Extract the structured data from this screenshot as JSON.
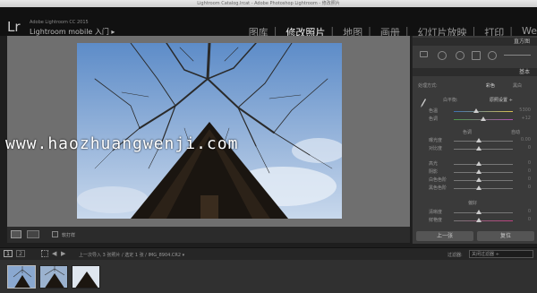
{
  "window": {
    "title": "Lightroom Catalog.lrcat - Adobe Photoshop Lightroom - 修改照片"
  },
  "identity": {
    "logo": "Lr",
    "product_line": "Adobe Lightroom CC 2015",
    "mobile_label": "Lightroom mobile 入门 ▸"
  },
  "modules": [
    {
      "label": "图库",
      "active": false
    },
    {
      "label": "修改照片",
      "active": true
    },
    {
      "label": "地图",
      "active": false
    },
    {
      "label": "画册",
      "active": false
    },
    {
      "label": "幻灯片放映",
      "active": false
    },
    {
      "label": "打印",
      "active": false
    },
    {
      "label": "We",
      "active": false
    }
  ],
  "watermark": "www.haozhuangwenji.com",
  "right_panel": {
    "histogram_label": "直方图",
    "basic_label": "基本",
    "treatment_label": "处理方式:",
    "color_option": "彩色",
    "bw_option": "黑白",
    "wb_label": "白平衡:",
    "wb_value": "原照设置 ÷",
    "temp_label": "色温",
    "temp_value": "5300",
    "tint_label": "色调",
    "tint_value": "+12",
    "tone_label": "色调",
    "auto_label": "自动",
    "exposure_label": "曝光度",
    "exposure_value": "0.00",
    "contrast_label": "对比度",
    "contrast_value": "0",
    "highlights_label": "高光",
    "highlights_value": "0",
    "shadows_label": "阴影",
    "shadows_value": "0",
    "whites_label": "白色色阶",
    "whites_value": "0",
    "blacks_label": "黑色色阶",
    "blacks_value": "0",
    "presence_label": "偏好",
    "clarity_label": "清晰度",
    "clarity_value": "0",
    "vibrance_label": "鲜艳度",
    "vibrance_value": "0",
    "prev_button": "上一张",
    "reset_button": "复位"
  },
  "toolbar": {
    "proof_label": "软打样"
  },
  "filmstrip_bar": {
    "page1": "1",
    "page2": "2",
    "path": "上一次导入  3 张照片 / 选定 1 张 / IMG_8904.CR2 ▾",
    "filter_label": "过滤器:",
    "filter_value": "关闭过滤器 ÷"
  },
  "colors": {
    "accent_blue": "#3d6fb0",
    "active_text": "#eeeeee"
  }
}
